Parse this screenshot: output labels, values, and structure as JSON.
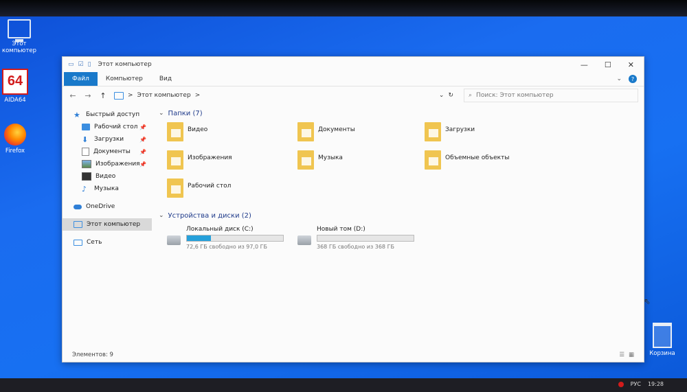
{
  "desktop": {
    "icons": [
      {
        "label": "Этот компьютер",
        "icon": "computer-icon"
      },
      {
        "label": "AIDA64",
        "glyph": "64",
        "icon": "aida64-icon"
      },
      {
        "label": "Firefox",
        "icon": "firefox-icon"
      },
      {
        "label": "Корзина",
        "icon": "recycle-bin-icon"
      }
    ]
  },
  "window": {
    "title": "Этот компьютер",
    "controls": {
      "minimize": "—",
      "maximize": "☐",
      "close": "✕"
    },
    "ribbon": {
      "tabs": [
        "Файл",
        "Компьютер",
        "Вид"
      ],
      "expand": "⌄",
      "help": "?"
    },
    "nav": {
      "back": "←",
      "forward": "→",
      "up": "↑",
      "address_sep": ">",
      "address": "Этот компьютер",
      "address_sep2": ">",
      "dropdown": "⌄",
      "refresh": "↻",
      "search_placeholder": "Поиск: Этот компьютер"
    },
    "sidebar": {
      "quick_access": "Быстрый доступ",
      "quick_items": [
        {
          "label": "Рабочий стол",
          "pinned": true
        },
        {
          "label": "Загрузки",
          "pinned": true
        },
        {
          "label": "Документы",
          "pinned": true
        },
        {
          "label": "Изображения",
          "pinned": true
        },
        {
          "label": "Видео",
          "pinned": false
        },
        {
          "label": "Музыка",
          "pinned": false
        }
      ],
      "onedrive": "OneDrive",
      "this_pc": "Этот компьютер",
      "network": "Сеть",
      "pin_glyph": "📌"
    },
    "content": {
      "folders_header": "Папки (7)",
      "folders": [
        "Видео",
        "Документы",
        "Загрузки",
        "Изображения",
        "Музыка",
        "Объемные объекты",
        "Рабочий стол"
      ],
      "drives_header": "Устройства и диски (2)",
      "drives": [
        {
          "name": "Локальный диск (C:)",
          "free": "72,6 ГБ свободно из 97,0 ГБ",
          "used_fraction": 0.25
        },
        {
          "name": "Новый том (D:)",
          "free": "368 ГБ свободно из 368 ГБ",
          "used_fraction": 0.0
        }
      ]
    },
    "status": {
      "items": "Элементов: 9"
    }
  },
  "taskbar": {
    "time": "19:28",
    "lang": "РУС"
  }
}
